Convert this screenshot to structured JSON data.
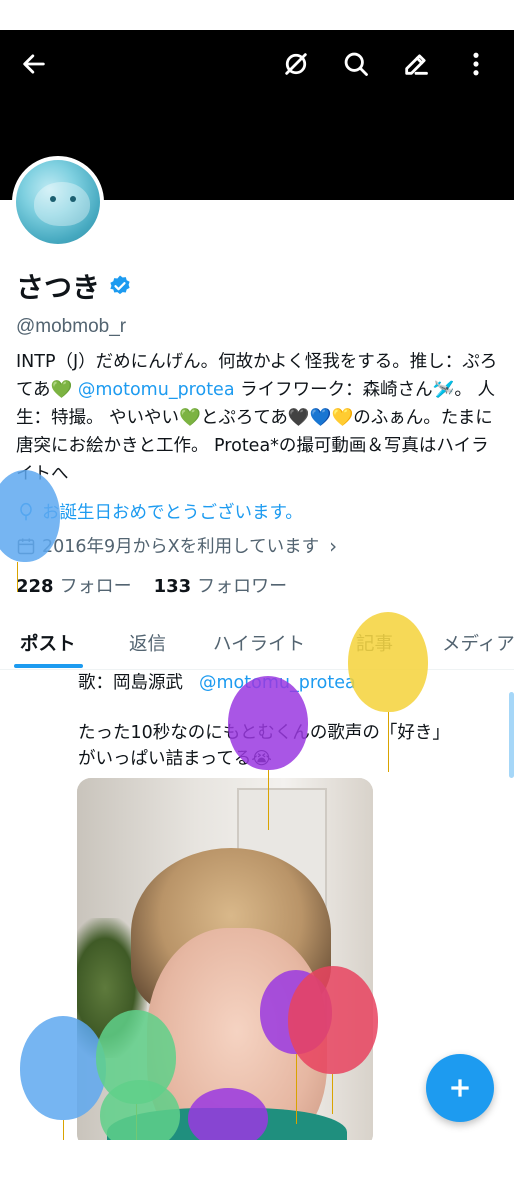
{
  "profile": {
    "name": "さつき",
    "handle": "@mobmob_r",
    "bio": {
      "p1": "INTP（J）だめにんげん。何故かよく怪我をする。推し：ぷろてあ",
      "heart1": "💚",
      "mention": "@motomu_protea",
      "p2": " ライフワーク：森崎さん",
      "plane": "🛩️",
      "p3": "。 人生：特撮。 やいやい",
      "heart2": "💚",
      "p4": "とぷろてあ",
      "heart3": "🖤",
      "heart4": "💙",
      "heart5": "💛",
      "p5": "のふぁん。たまに唐突にお絵かきと工作。 Protea*の撮可動画＆写真はハイライトへ"
    },
    "birthday": "お誕生日おめでとうございます。",
    "joined": "2016年9月からXを利用しています",
    "following_count": "228",
    "following_label": "フォロー",
    "followers_count": "133",
    "followers_label": "フォロワー"
  },
  "tabs": [
    {
      "label": "ポスト"
    },
    {
      "label": "返信"
    },
    {
      "label": "ハイライト"
    },
    {
      "label": "記事"
    },
    {
      "label": "メディア"
    }
  ],
  "tweet": {
    "line1_prefix": "歌：岡島源武",
    "line1_mention": "@motomu_protea",
    "line2": "たった10秒なのにもとむくんの歌声の「好き」",
    "line3": "がいっぱい詰まってる😭"
  },
  "icons": {
    "back": "arrow-left-icon",
    "noeye": "slash-circle-icon",
    "search": "search-icon",
    "edit": "pencil-icon",
    "more": "more-vertical-icon",
    "compose": "plus-icon"
  },
  "colors": {
    "accent": "#1d9bf0",
    "text": "#0f1419",
    "muted": "#536471"
  }
}
